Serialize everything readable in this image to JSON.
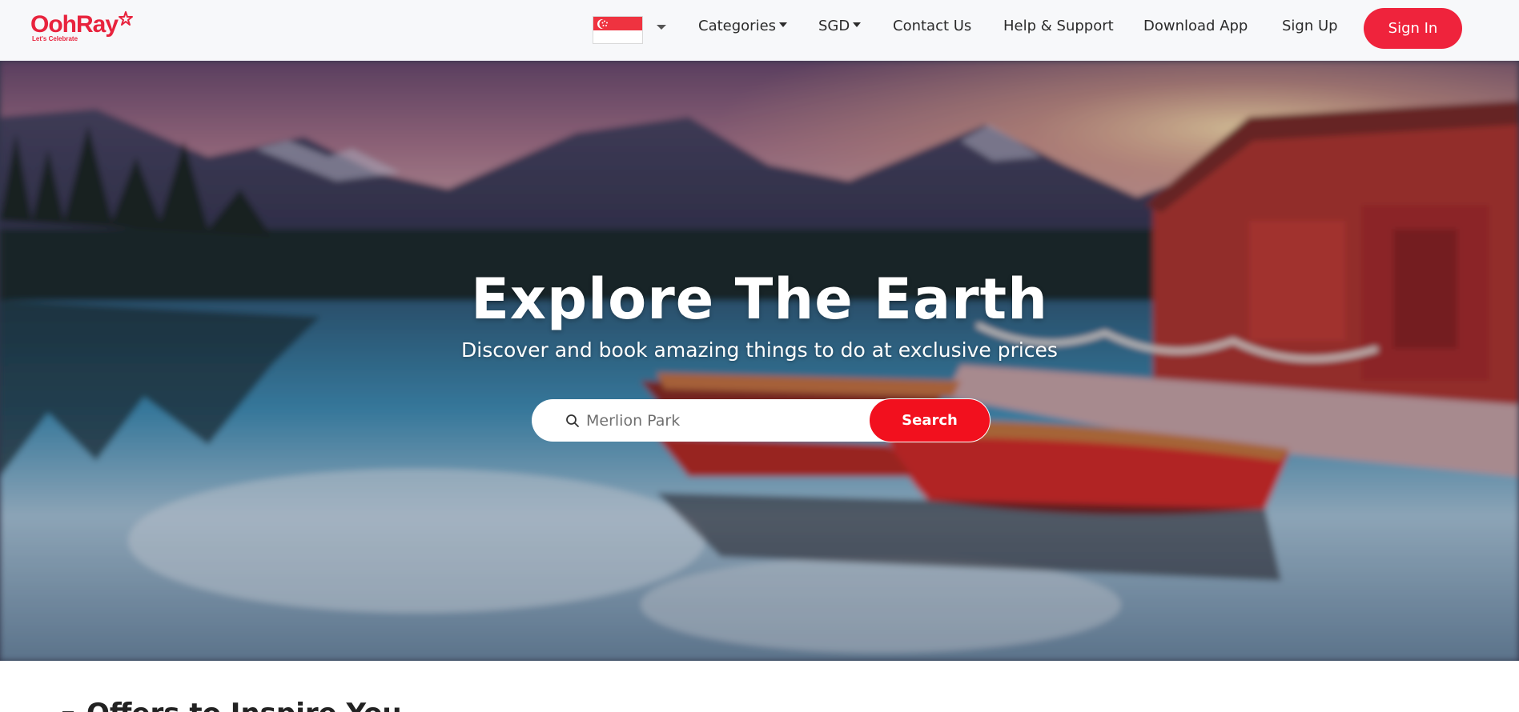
{
  "brand": {
    "name": "OohRay",
    "tagline": "Let's Celebrate",
    "color": "#e8233d"
  },
  "header": {
    "country_flag": "singapore-flag",
    "nav": {
      "categories": "Categories",
      "currency": "SGD",
      "contact": "Contact Us",
      "help": "Help & Support",
      "download": "Download App",
      "signup": "Sign Up",
      "signin": "Sign In"
    },
    "signin_color": "#ef233c"
  },
  "hero": {
    "title": "Explore The Earth",
    "subtitle": "Discover and book amazing things to do at exclusive prices",
    "search": {
      "placeholder": "Merlion Park",
      "button_label": "Search",
      "button_color": "#f2101e",
      "icon": "search-icon"
    }
  },
  "offers": {
    "title": "Offers to Inspire You",
    "icon": "list-icon"
  }
}
